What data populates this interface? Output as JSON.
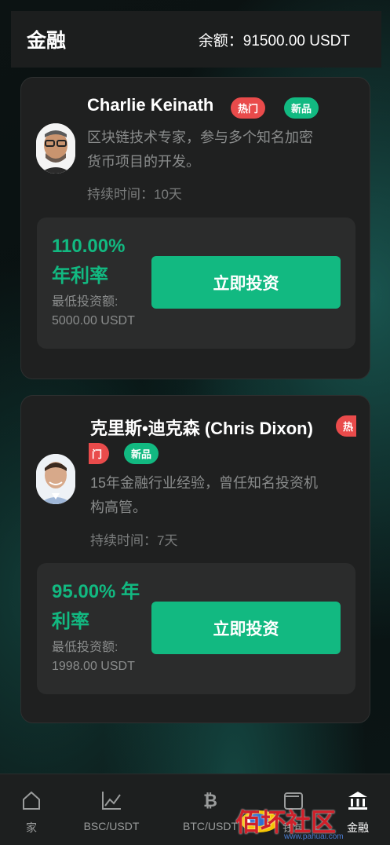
{
  "header": {
    "title": "金融",
    "balance": "余额：91500.00 USDT"
  },
  "products": [
    {
      "name": "Charlie Keinath",
      "badges": {
        "hot": "热门",
        "new": "新品"
      },
      "description_lines": [
        "区块链技术专家，参与多个知名加密",
        "货币项目的开发。"
      ],
      "duration": "持续时间：10天",
      "rate_lines": [
        "110.00%",
        "年利率"
      ],
      "min_lines": [
        "最低投资额:",
        "5000.00 USDT"
      ],
      "button": "立即投资"
    },
    {
      "name": "克里斯•迪克森 (Chris Dixon)",
      "badges": {
        "hot_part1": "热",
        "hot_part2": "门",
        "new": "新品"
      },
      "description_lines": [
        "15年金融行业经验，曾任知名投资机",
        "构高管。"
      ],
      "duration": "持续时间：7天",
      "rate_lines": [
        "95.00% 年",
        "利率"
      ],
      "min_lines": [
        "最低投资额:",
        "1998.00 USDT"
      ],
      "button": "立即投资"
    }
  ],
  "tabbar": [
    {
      "label": "家",
      "icon": "home-icon"
    },
    {
      "label": "BSC/USDT",
      "icon": "chart-line-icon"
    },
    {
      "label": "BTC/USDT",
      "icon": "bitcoin-icon"
    },
    {
      "label": "钱包",
      "icon": "wallet-icon"
    },
    {
      "label": "金融",
      "icon": "bank-icon"
    }
  ],
  "watermark": {
    "text": "佰坏社区",
    "url": "www.pahuai.com"
  },
  "colors": {
    "accent": "#12b981",
    "hot": "#e94b4b",
    "card": "#1f2020",
    "box": "#2b2c2c"
  }
}
